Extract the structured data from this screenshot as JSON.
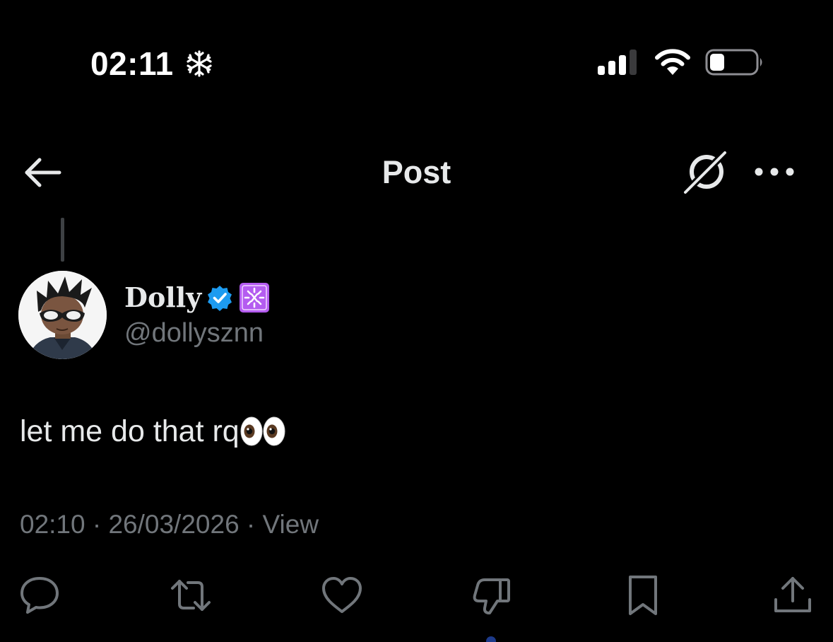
{
  "status_bar": {
    "time": "02:11",
    "icons": [
      "snowflake-icon",
      "signal-icon",
      "wifi-icon",
      "battery-icon"
    ]
  },
  "header": {
    "title": "Post",
    "icons": [
      "back-arrow-icon",
      "grok-icon",
      "more-icon"
    ]
  },
  "post": {
    "author": {
      "display_name": "Dolly",
      "handle": "@dollysznn",
      "badges": [
        "verified-icon",
        "affiliate-badge"
      ]
    },
    "text": "let me do that rq",
    "emoji": "eyes-emoji",
    "meta": "02:10 · 26/03/2026 · View"
  },
  "actions": [
    "reply-icon",
    "repost-icon",
    "like-icon",
    "dislike-icon",
    "bookmark-icon",
    "share-icon"
  ],
  "colors": {
    "background": "#000000",
    "text_primary": "#e7e9ea",
    "text_secondary": "#71767b",
    "verified_blue": "#1d9bf0",
    "affiliate_purple": "#b45cf0"
  }
}
